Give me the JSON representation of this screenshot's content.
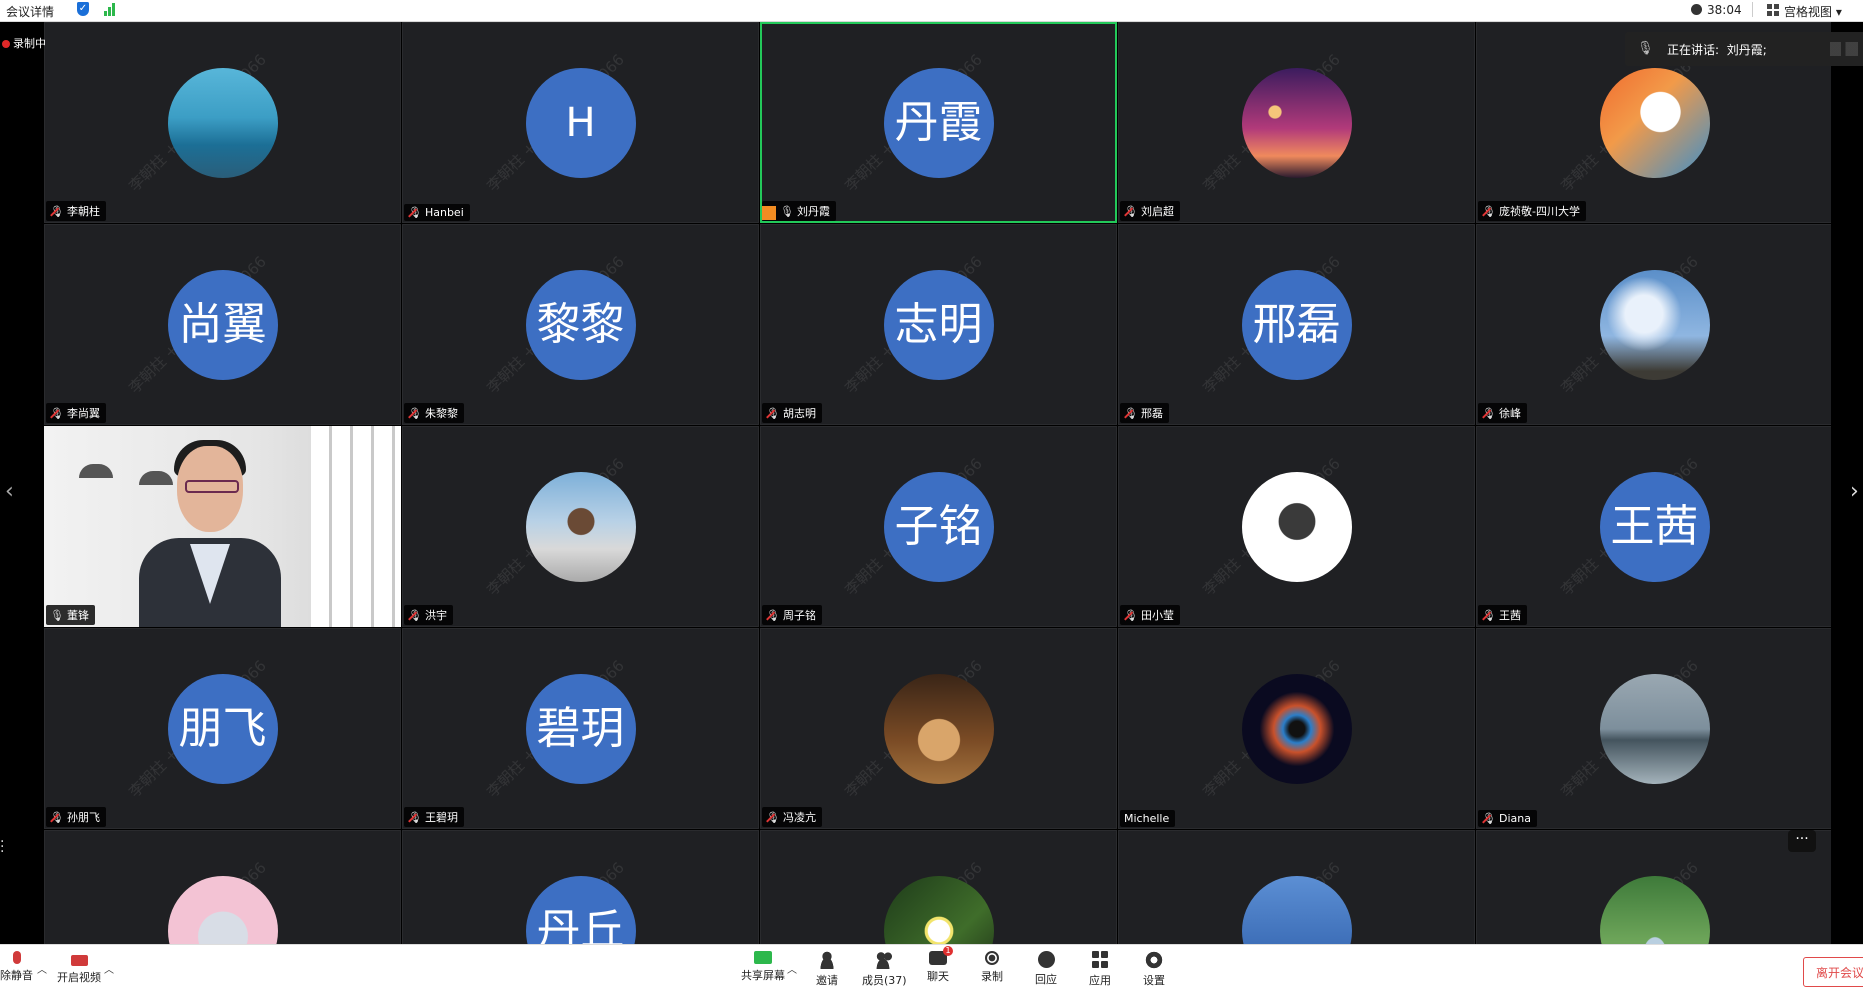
{
  "top_bar": {
    "meeting_info": "会议详情",
    "timer": "38:04",
    "view_mode": "宫格视图 ▾"
  },
  "stage": {
    "recording": "录制中",
    "speaking_label": "正在讲话:",
    "speaking_name": "刘丹霞;",
    "watermark": "李朝柱 +8618067679066",
    "more_button": "···"
  },
  "participants": [
    {
      "name": "李朝柱",
      "avatar_type": "image",
      "picture": "sea-pier",
      "mic": "muted"
    },
    {
      "name": "Hanbei",
      "avatar_type": "text",
      "avatar_text": "H",
      "mic": "muted"
    },
    {
      "name": "刘丹霞",
      "avatar_type": "text",
      "avatar_text": "丹霞",
      "mic": "on",
      "active_speaker": true
    },
    {
      "name": "刘启超",
      "avatar_type": "image",
      "picture": "sunset-couple",
      "mic": "muted"
    },
    {
      "name": "庞祯敬-四川大学",
      "avatar_type": "image",
      "picture": "cartoon-character",
      "mic": "muted"
    },
    {
      "name": "李尚翼",
      "avatar_type": "text",
      "avatar_text": "尚翼",
      "mic": "muted"
    },
    {
      "name": "朱黎黎",
      "avatar_type": "text",
      "avatar_text": "黎黎",
      "mic": "muted"
    },
    {
      "name": "胡志明",
      "avatar_type": "text",
      "avatar_text": "志明",
      "mic": "muted"
    },
    {
      "name": "邢磊",
      "avatar_type": "text",
      "avatar_text": "邢磊",
      "mic": "muted"
    },
    {
      "name": "徐峰",
      "avatar_type": "image",
      "picture": "blue-sky",
      "mic": "muted"
    },
    {
      "name": "董锋",
      "avatar_type": "video",
      "mic": "on"
    },
    {
      "name": "洪宇",
      "avatar_type": "image",
      "picture": "man-outdoor",
      "mic": "muted"
    },
    {
      "name": "周子铭",
      "avatar_type": "text",
      "avatar_text": "子铭",
      "mic": "muted"
    },
    {
      "name": "田小莹",
      "avatar_type": "image",
      "picture": "cartoon-dog",
      "mic": "muted"
    },
    {
      "name": "王茜",
      "avatar_type": "text",
      "avatar_text": "王茜",
      "mic": "muted"
    },
    {
      "name": "孙朋飞",
      "avatar_type": "text",
      "avatar_text": "朋飞",
      "mic": "muted"
    },
    {
      "name": "王碧玥",
      "avatar_type": "text",
      "avatar_text": "碧玥",
      "mic": "muted"
    },
    {
      "name": "冯凌亢",
      "avatar_type": "image",
      "picture": "cat-doorway",
      "mic": "muted"
    },
    {
      "name": "Michelle",
      "avatar_type": "image",
      "picture": "nebula",
      "mic": "none"
    },
    {
      "name": "Diana",
      "avatar_type": "image",
      "picture": "misty-lake",
      "mic": "muted"
    },
    {
      "name": "",
      "avatar_type": "image",
      "picture": "anime-character",
      "mic": "none"
    },
    {
      "name": "",
      "avatar_type": "text",
      "avatar_text": "丹丘",
      "mic": "none"
    },
    {
      "name": "",
      "avatar_type": "image",
      "picture": "white-flower",
      "mic": "none"
    },
    {
      "name": "",
      "avatar_type": "image",
      "picture": "snowy-branches",
      "mic": "none"
    },
    {
      "name": "",
      "avatar_type": "image",
      "picture": "forest-woman",
      "mic": "none"
    }
  ],
  "toolbar": {
    "unmute": "除静音",
    "start_video": "开启视频",
    "share_screen": "共享屏幕",
    "invite": "邀请",
    "members": "成员(37)",
    "chat": "聊天",
    "chat_badge": "1",
    "record": "录制",
    "reactions": "回应",
    "apps": "应用",
    "settings": "设置",
    "leave": "离开会议"
  },
  "colors": {
    "avatar_blue": "#3d6fc3",
    "active_speaker_border": "#23c95a",
    "tile_background": "#1f2023",
    "leave_red": "#e04a4a"
  }
}
